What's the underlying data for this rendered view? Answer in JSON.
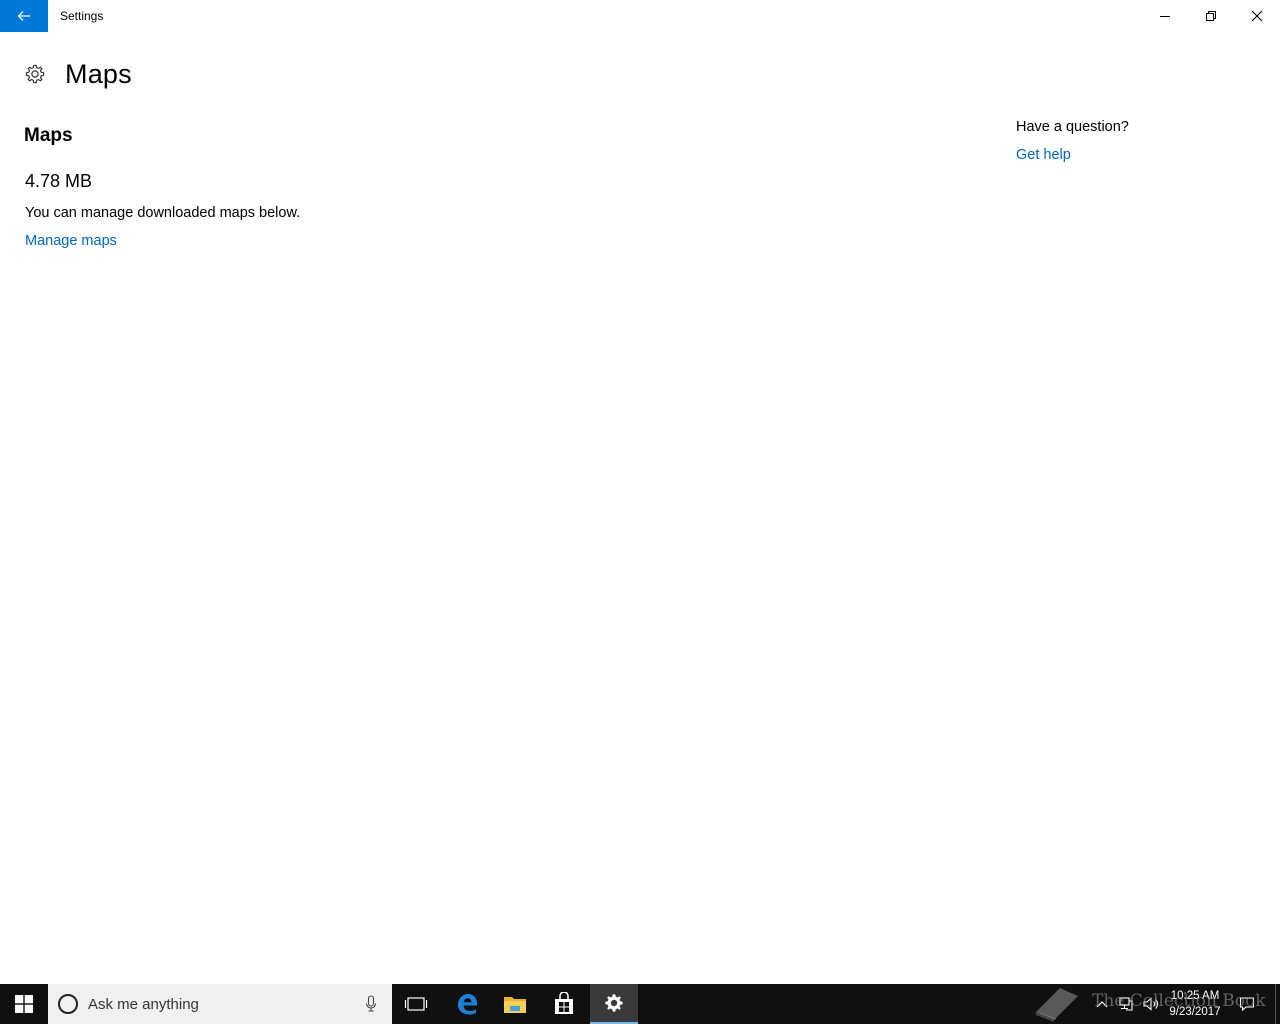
{
  "window": {
    "title": "Settings"
  },
  "page": {
    "title": "Maps",
    "icon": "gear-icon"
  },
  "content": {
    "section_title": "Maps",
    "storage_size": "4.78 MB",
    "description": "You can manage downloaded maps below.",
    "manage_link": "Manage maps"
  },
  "help": {
    "heading": "Have a question?",
    "link": "Get help"
  },
  "taskbar": {
    "search_placeholder": "Ask me anything",
    "pinned": [
      "task-view-icon",
      "edge-icon",
      "file-explorer-icon",
      "store-icon",
      "settings-icon"
    ],
    "active_app": "settings-icon",
    "clock_time": "10:25 AM",
    "clock_date": "9/23/2017"
  },
  "watermark": {
    "text": "The Collection Book"
  },
  "colors": {
    "accent": "#0078d7",
    "link": "#0067c0",
    "taskbar": "#101010"
  }
}
